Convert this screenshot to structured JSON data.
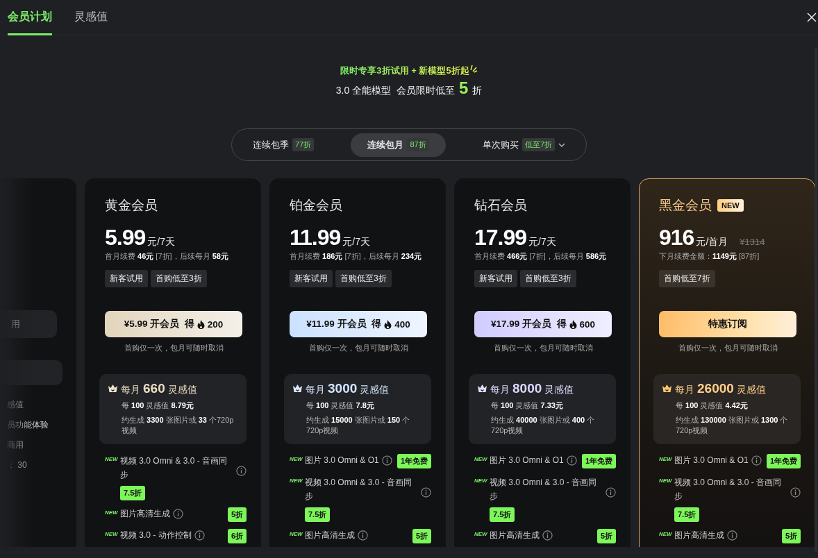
{
  "tabs": [
    {
      "label": "会员计划",
      "selected": true
    },
    {
      "label": "灵感值",
      "selected": false
    }
  ],
  "promo": {
    "headline": "限时专享3折试用 + 新模型5折起",
    "prefix": "3.0 全能模型  会员限时低至",
    "highlight": "5",
    "suffix": "折"
  },
  "billing_options": [
    {
      "label": "连续包季",
      "discount": "77折",
      "selected": false,
      "dropdown": false
    },
    {
      "label": "连续包月",
      "discount": "87折",
      "selected": true,
      "dropdown": false
    },
    {
      "label": "单次购买",
      "discount": "低至7折",
      "selected": false,
      "dropdown": true
    }
  ],
  "partial_card": {
    "button_text": "用",
    "texts": [
      "感值",
      "员功能体验",
      "商用",
      "： 30"
    ]
  },
  "cards": [
    {
      "kind": "gold",
      "name": "黄金会员",
      "price": "5.99",
      "unit": "元/7天",
      "renewal": "首月续费 **46元** [7折]，后续每月 **58元**",
      "tags": [
        "新客试用",
        "首购低至3折"
      ],
      "button": {
        "label": "¥5.99 开会员",
        "earn": "得",
        "points": "200"
      },
      "note": "首购仅一次，包月可随时取消",
      "credits": {
        "prefix": "每月",
        "amount": "660",
        "unit": "灵感值",
        "rate": "每 **100** 灵感值 **8.79元**",
        "estimate": "约生成 **3300** 张图片或 **33** 个720p视频"
      },
      "features": [
        {
          "tag": "NEW",
          "text": "视频 3.0 Omni & 3.0 - 音画同步",
          "discount": "7.5折",
          "kind": "stacked"
        },
        {
          "tag": "NEW",
          "text": "图片高清生成",
          "discount": "5折",
          "kind": "inline"
        },
        {
          "tag": "NEW",
          "text": "视频 3.0 - 动作控制",
          "discount": "6折",
          "kind": "inline"
        }
      ]
    },
    {
      "kind": "platinum",
      "name": "铂金会员",
      "price": "11.99",
      "unit": "元/7天",
      "renewal": "首月续费 **186元** [7折]，后续每月 **234元**",
      "tags": [
        "新客试用",
        "首购低至3折"
      ],
      "button": {
        "label": "¥11.99 开会员",
        "earn": "得",
        "points": "400"
      },
      "note": "首购仅一次，包月可随时取消",
      "credits": {
        "prefix": "每月",
        "amount": "3000",
        "unit": "灵感值",
        "rate": "每 **100** 灵感值 **7.8元**",
        "estimate": "约生成 **15000** 张图片或 **150** 个720p视频"
      },
      "features": [
        {
          "tag": "NEW",
          "text": "图片 3.0 Omni & O1",
          "discount": "1年免费",
          "kind": "inline"
        },
        {
          "tag": "NEW",
          "text": "视频 3.0 Omni & 3.0 - 音画同步",
          "discount": "7.5折",
          "kind": "stacked"
        },
        {
          "tag": "NEW",
          "text": "图片高清生成",
          "discount": "5折",
          "kind": "inline"
        }
      ]
    },
    {
      "kind": "diamond",
      "name": "钻石会员",
      "price": "17.99",
      "unit": "元/7天",
      "renewal": "首月续费 **466元** [7折]，后续每月 **586元**",
      "tags": [
        "新客试用",
        "首购低至3折"
      ],
      "button": {
        "label": "¥17.99 开会员",
        "earn": "得",
        "points": "600"
      },
      "note": "首购仅一次，包月可随时取消",
      "credits": {
        "prefix": "每月",
        "amount": "8000",
        "unit": "灵感值",
        "rate": "每 **100** 灵感值 **7.33元**",
        "estimate": "约生成 **40000** 张图片或 **400** 个720p视频"
      },
      "features": [
        {
          "tag": "NEW",
          "text": "图片 3.0 Omni & O1",
          "discount": "1年免费",
          "kind": "inline"
        },
        {
          "tag": "NEW",
          "text": "视频 3.0 Omni & 3.0 - 音画同步",
          "discount": "7.5折",
          "kind": "stacked"
        },
        {
          "tag": "NEW",
          "text": "图片高清生成",
          "discount": "5折",
          "kind": "inline"
        }
      ]
    },
    {
      "kind": "black",
      "name": "黑金会员",
      "badge": "NEW",
      "price": "916",
      "unit": "元/首月",
      "original_price": "¥1314",
      "renewal": "下月续费金额：**1149元** [87折]",
      "tags": [
        "首购低至7折"
      ],
      "button": {
        "label": "特惠订阅"
      },
      "note": "首购仅一次，包月可随时取消",
      "credits": {
        "prefix": "每月",
        "amount": "26000",
        "unit": "灵感值",
        "rate": "每 **100** 灵感值 **4.42元**",
        "estimate": "约生成 **130000** 张图片或 **1300** 个720p视频"
      },
      "features": [
        {
          "tag": "NEW",
          "text": "图片 3.0 Omni & O1",
          "discount": "1年免费",
          "kind": "inline"
        },
        {
          "tag": "NEW",
          "text": "视频 3.0 Omni & 3.0 - 音画同步",
          "discount": "7.5折",
          "kind": "stacked"
        },
        {
          "tag": "NEW",
          "text": "图片高清生成",
          "discount": "5折",
          "kind": "inline"
        }
      ]
    }
  ]
}
